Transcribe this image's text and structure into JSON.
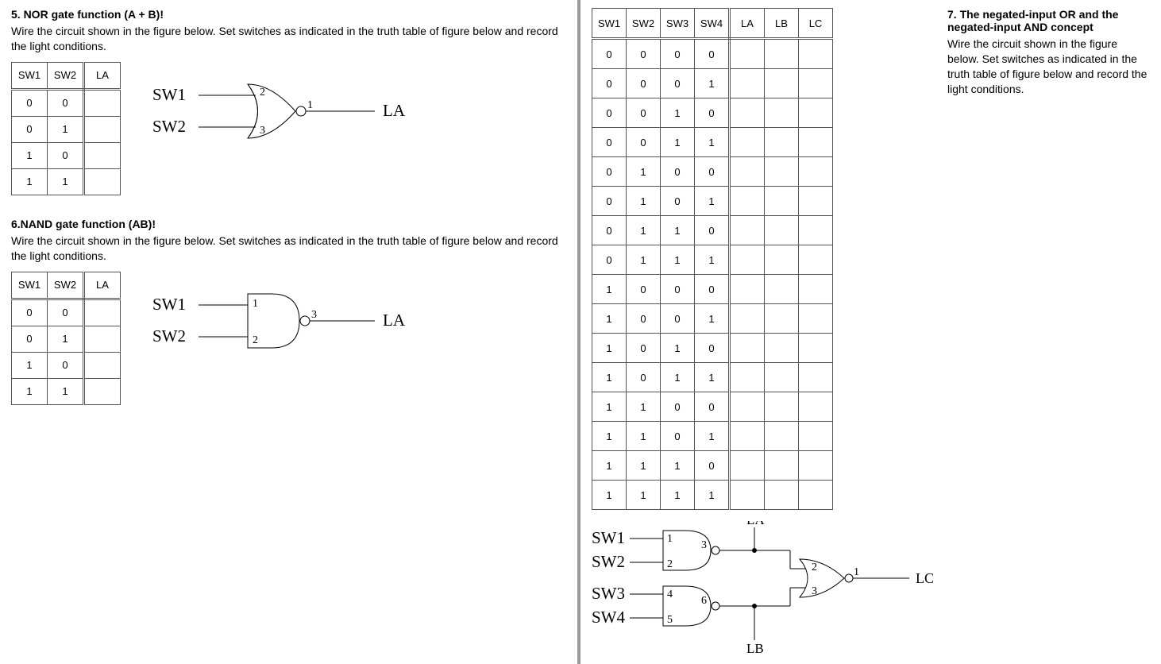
{
  "section5": {
    "title": "5. NOR gate function (A + B)!",
    "desc": "Wire the circuit shown in the figure below. Set switches as indicated in the truth table of figure below and record the light conditions.",
    "table": {
      "headers": [
        "SW1",
        "SW2",
        "LA"
      ],
      "rows": [
        [
          "0",
          "0",
          ""
        ],
        [
          "0",
          "1",
          ""
        ],
        [
          "1",
          "0",
          ""
        ],
        [
          "1",
          "1",
          ""
        ]
      ]
    },
    "diagram": {
      "in1": "SW1",
      "in2": "SW2",
      "out": "LA",
      "p1": "2",
      "p2": "3",
      "po": "1"
    }
  },
  "section6": {
    "title": "6.NAND gate function (AB)!",
    "desc": "Wire the circuit shown in the figure below. Set switches as indicated in the truth table of figure below and record the light conditions.",
    "table": {
      "headers": [
        "SW1",
        "SW2",
        "LA"
      ],
      "rows": [
        [
          "0",
          "0",
          ""
        ],
        [
          "0",
          "1",
          ""
        ],
        [
          "1",
          "0",
          ""
        ],
        [
          "1",
          "1",
          ""
        ]
      ]
    },
    "diagram": {
      "in1": "SW1",
      "in2": "SW2",
      "out": "LA",
      "p1": "1",
      "p2": "2",
      "po": "3"
    }
  },
  "section7": {
    "title": "7. The negated-input OR and the negated-input AND concept",
    "desc": "Wire the circuit shown in the figure below. Set switches as indicated in the truth table of figure below and record the light conditions.",
    "table": {
      "headers": [
        "SW1",
        "SW2",
        "SW3",
        "SW4",
        "LA",
        "LB",
        "LC"
      ],
      "rows": [
        [
          "0",
          "0",
          "0",
          "0",
          "",
          "",
          ""
        ],
        [
          "0",
          "0",
          "0",
          "1",
          "",
          "",
          ""
        ],
        [
          "0",
          "0",
          "1",
          "0",
          "",
          "",
          ""
        ],
        [
          "0",
          "0",
          "1",
          "1",
          "",
          "",
          ""
        ],
        [
          "0",
          "1",
          "0",
          "0",
          "",
          "",
          ""
        ],
        [
          "0",
          "1",
          "0",
          "1",
          "",
          "",
          ""
        ],
        [
          "0",
          "1",
          "1",
          "0",
          "",
          "",
          ""
        ],
        [
          "0",
          "1",
          "1",
          "1",
          "",
          "",
          ""
        ],
        [
          "1",
          "0",
          "0",
          "0",
          "",
          "",
          ""
        ],
        [
          "1",
          "0",
          "0",
          "1",
          "",
          "",
          ""
        ],
        [
          "1",
          "0",
          "1",
          "0",
          "",
          "",
          ""
        ],
        [
          "1",
          "0",
          "1",
          "1",
          "",
          "",
          ""
        ],
        [
          "1",
          "1",
          "0",
          "0",
          "",
          "",
          ""
        ],
        [
          "1",
          "1",
          "0",
          "1",
          "",
          "",
          ""
        ],
        [
          "1",
          "1",
          "1",
          "0",
          "",
          "",
          ""
        ],
        [
          "1",
          "1",
          "1",
          "1",
          "",
          "",
          ""
        ]
      ]
    },
    "diagram": {
      "in1": "SW1",
      "in2": "SW2",
      "in3": "SW3",
      "in4": "SW4",
      "outA": "LA",
      "outB": "LB",
      "outC": "LC",
      "g1p1": "1",
      "g1p2": "2",
      "g1po": "3",
      "g2p1": "4",
      "g2p2": "5",
      "g2po": "6",
      "g3p1": "2",
      "g3p2": "3",
      "g3po": "1"
    }
  }
}
